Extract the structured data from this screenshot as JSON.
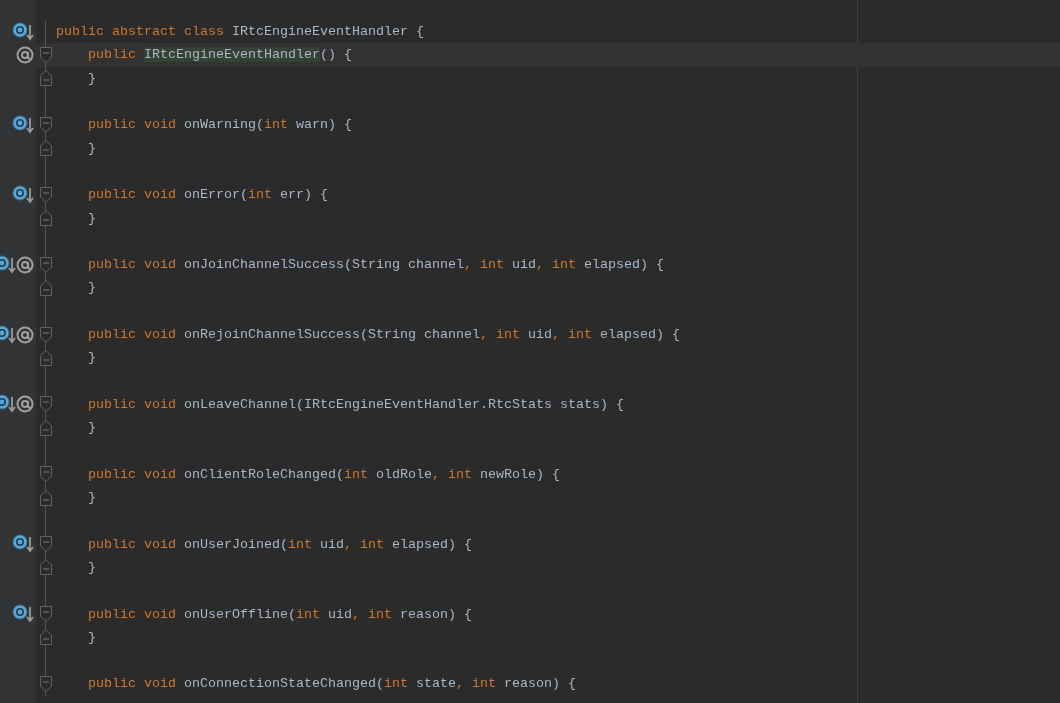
{
  "editor": {
    "lines": [
      {
        "kind": "header",
        "overridden": true,
        "annotated": false,
        "current": false,
        "tokens": [
          {
            "kind": "keyword",
            "text": "public abstract class"
          },
          {
            "kind": "plain",
            "text": " IRtcEngineEventHandler {"
          }
        ],
        "children": [
          {
            "kind": "open",
            "overridden": false,
            "annotated": true,
            "current": true,
            "tokens": [
              {
                "kind": "keyword",
                "text": "public "
              },
              {
                "kind": "highlight",
                "text": "IRtcEngineEventHandler"
              },
              {
                "kind": "plain",
                "text": "() {"
              }
            ]
          },
          {
            "kind": "close",
            "current": false,
            "tokens": [
              {
                "kind": "plain",
                "text": "}"
              }
            ]
          },
          {
            "kind": "blank"
          },
          {
            "kind": "open",
            "overridden": true,
            "annotated": false,
            "current": false,
            "tokens": [
              {
                "kind": "keyword",
                "text": "public void"
              },
              {
                "kind": "plain",
                "text": " onWarning("
              },
              {
                "kind": "keyword",
                "text": "int"
              },
              {
                "kind": "plain",
                "text": " warn) {"
              }
            ]
          },
          {
            "kind": "close",
            "current": false,
            "tokens": [
              {
                "kind": "plain",
                "text": "}"
              }
            ]
          },
          {
            "kind": "blank"
          },
          {
            "kind": "open",
            "overridden": true,
            "annotated": false,
            "current": false,
            "tokens": [
              {
                "kind": "keyword",
                "text": "public void"
              },
              {
                "kind": "plain",
                "text": " onError("
              },
              {
                "kind": "keyword",
                "text": "int"
              },
              {
                "kind": "plain",
                "text": " err) {"
              }
            ]
          },
          {
            "kind": "close",
            "current": false,
            "tokens": [
              {
                "kind": "plain",
                "text": "}"
              }
            ]
          },
          {
            "kind": "blank"
          },
          {
            "kind": "open",
            "overridden": true,
            "annotated": true,
            "current": false,
            "tokens": [
              {
                "kind": "keyword",
                "text": "public void"
              },
              {
                "kind": "plain",
                "text": " onJoinChannelSuccess(String channel"
              },
              {
                "kind": "keyword",
                "text": ", int"
              },
              {
                "kind": "plain",
                "text": " uid"
              },
              {
                "kind": "keyword",
                "text": ", int"
              },
              {
                "kind": "plain",
                "text": " elapsed) {"
              }
            ]
          },
          {
            "kind": "close",
            "current": false,
            "tokens": [
              {
                "kind": "plain",
                "text": "}"
              }
            ]
          },
          {
            "kind": "blank"
          },
          {
            "kind": "open",
            "overridden": true,
            "annotated": true,
            "current": false,
            "tokens": [
              {
                "kind": "keyword",
                "text": "public void"
              },
              {
                "kind": "plain",
                "text": " onRejoinChannelSuccess(String channel"
              },
              {
                "kind": "keyword",
                "text": ", int"
              },
              {
                "kind": "plain",
                "text": " uid"
              },
              {
                "kind": "keyword",
                "text": ", int"
              },
              {
                "kind": "plain",
                "text": " elapsed) {"
              }
            ]
          },
          {
            "kind": "close",
            "current": false,
            "tokens": [
              {
                "kind": "plain",
                "text": "}"
              }
            ]
          },
          {
            "kind": "blank"
          },
          {
            "kind": "open",
            "overridden": true,
            "annotated": true,
            "current": false,
            "tokens": [
              {
                "kind": "keyword",
                "text": "public void"
              },
              {
                "kind": "plain",
                "text": " onLeaveChannel(IRtcEngineEventHandler.RtcStats stats) {"
              }
            ]
          },
          {
            "kind": "close",
            "current": false,
            "tokens": [
              {
                "kind": "plain",
                "text": "}"
              }
            ]
          },
          {
            "kind": "blank"
          },
          {
            "kind": "open",
            "overridden": false,
            "annotated": false,
            "current": false,
            "tokens": [
              {
                "kind": "keyword",
                "text": "public void"
              },
              {
                "kind": "plain",
                "text": " onClientRoleChanged("
              },
              {
                "kind": "keyword",
                "text": "int"
              },
              {
                "kind": "plain",
                "text": " oldRole"
              },
              {
                "kind": "keyword",
                "text": ", int"
              },
              {
                "kind": "plain",
                "text": " newRole) {"
              }
            ]
          },
          {
            "kind": "close",
            "current": false,
            "tokens": [
              {
                "kind": "plain",
                "text": "}"
              }
            ]
          },
          {
            "kind": "blank"
          },
          {
            "kind": "open",
            "overridden": true,
            "annotated": false,
            "current": false,
            "tokens": [
              {
                "kind": "keyword",
                "text": "public void"
              },
              {
                "kind": "plain",
                "text": " onUserJoined("
              },
              {
                "kind": "keyword",
                "text": "int"
              },
              {
                "kind": "plain",
                "text": " uid"
              },
              {
                "kind": "keyword",
                "text": ", int"
              },
              {
                "kind": "plain",
                "text": " elapsed) {"
              }
            ]
          },
          {
            "kind": "close",
            "current": false,
            "tokens": [
              {
                "kind": "plain",
                "text": "}"
              }
            ]
          },
          {
            "kind": "blank"
          },
          {
            "kind": "open",
            "overridden": true,
            "annotated": false,
            "current": false,
            "tokens": [
              {
                "kind": "keyword",
                "text": "public void"
              },
              {
                "kind": "plain",
                "text": " onUserOffline("
              },
              {
                "kind": "keyword",
                "text": "int"
              },
              {
                "kind": "plain",
                "text": " uid"
              },
              {
                "kind": "keyword",
                "text": ", int"
              },
              {
                "kind": "plain",
                "text": " reason) {"
              }
            ]
          },
          {
            "kind": "close",
            "current": false,
            "tokens": [
              {
                "kind": "plain",
                "text": "}"
              }
            ]
          },
          {
            "kind": "blank"
          },
          {
            "kind": "open",
            "overridden": false,
            "annotated": false,
            "current": false,
            "tokens": [
              {
                "kind": "keyword",
                "text": "public void"
              },
              {
                "kind": "plain",
                "text": " onConnectionStateChanged("
              },
              {
                "kind": "keyword",
                "text": "int"
              },
              {
                "kind": "plain",
                "text": " state"
              },
              {
                "kind": "keyword",
                "text": ", int"
              },
              {
                "kind": "plain",
                "text": " reason) {"
              }
            ]
          }
        ]
      }
    ]
  }
}
